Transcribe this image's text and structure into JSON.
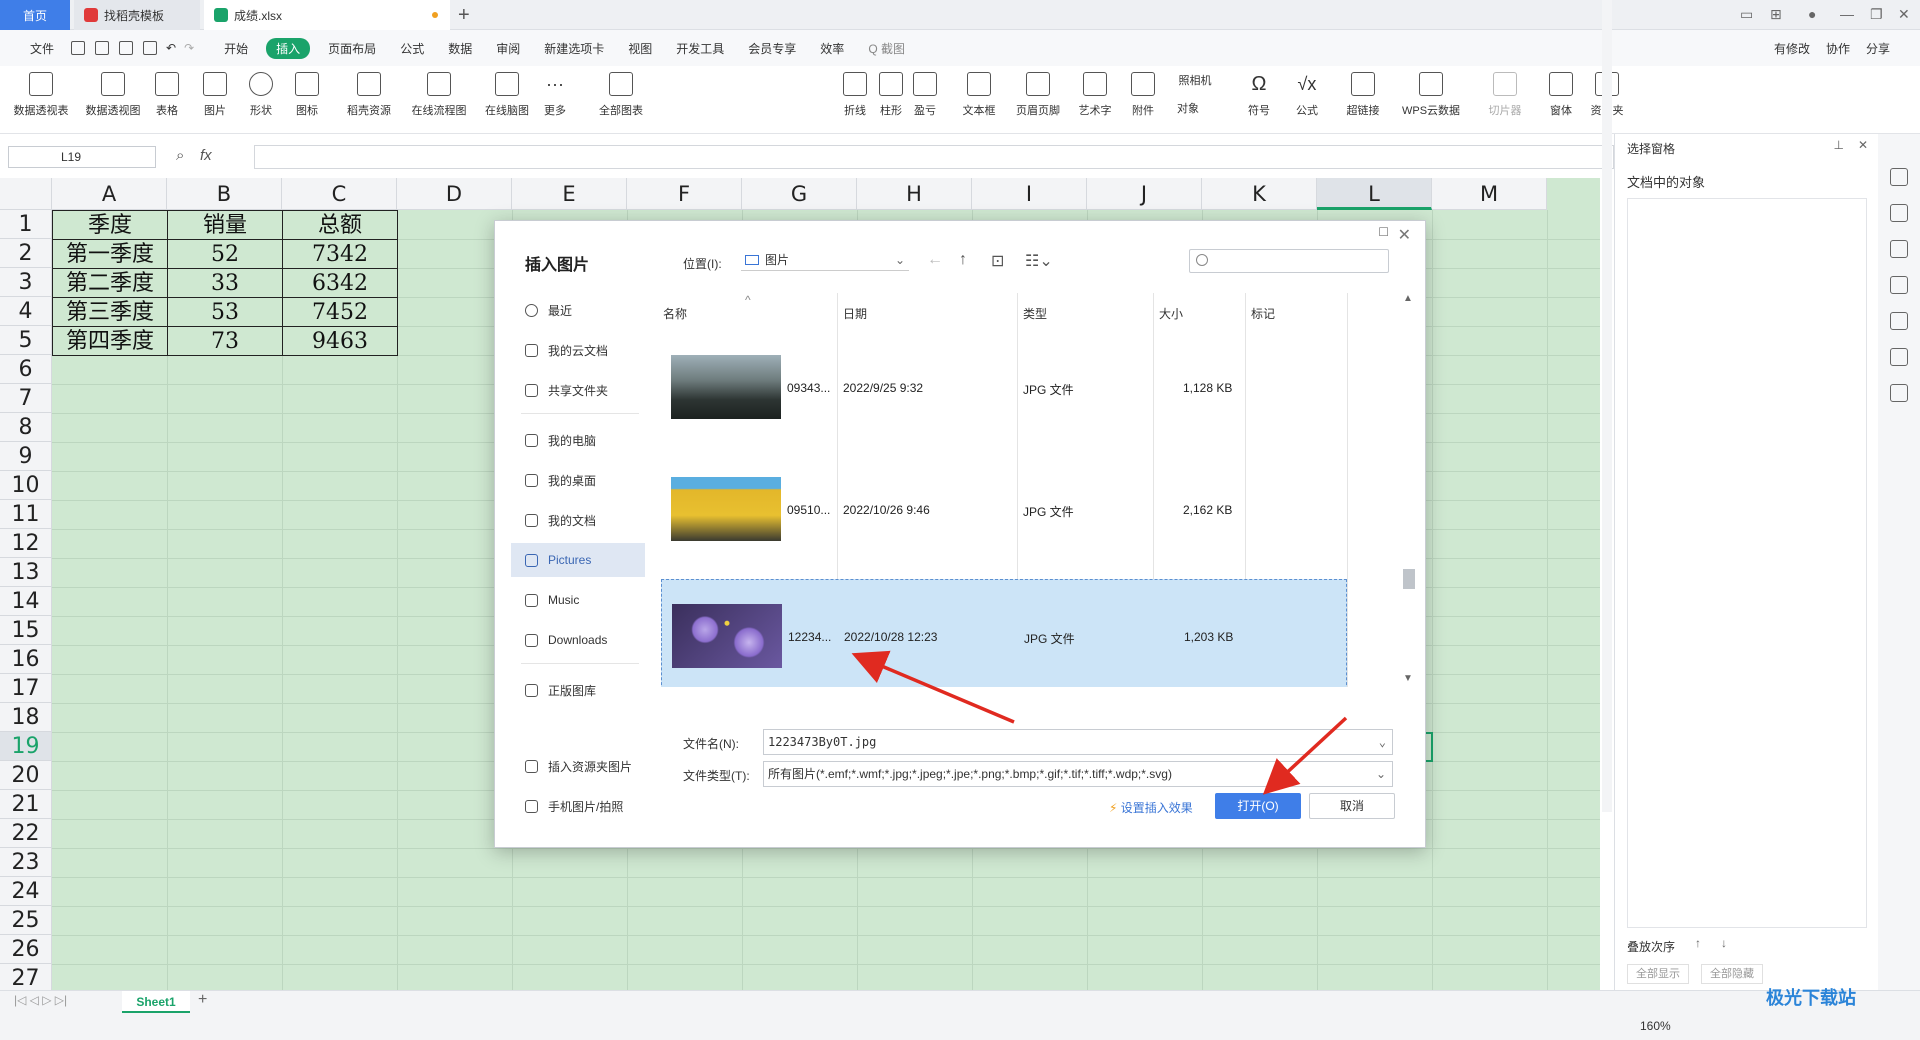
{
  "tabs": {
    "home": "首页",
    "doc1": "找稻壳模板",
    "doc2": "成绩.xlsx",
    "add": "+"
  },
  "menubar": {
    "file": "文件",
    "items": [
      "开始",
      "插入",
      "页面布局",
      "公式",
      "数据",
      "审阅",
      "新建选项卡",
      "视图",
      "开发工具",
      "会员专享",
      "效率"
    ],
    "active": "插入",
    "search": "Q 截图",
    "right": [
      "有修改",
      "协作",
      "分享"
    ]
  },
  "ribbon": [
    "数据透视表",
    "数据透视图",
    "表格",
    "图片",
    "形状",
    "图标",
    "稻壳资源",
    "在线流程图",
    "在线脑图",
    "更多",
    "全部图表",
    "折线",
    "柱形",
    "盈亏",
    "文本框",
    "页眉页脚",
    "艺术字",
    "附件",
    "照相机",
    "对象",
    "符号",
    "公式",
    "超链接",
    "WPS云数据",
    "切片器",
    "窗体",
    "资源夹"
  ],
  "formula_bar": {
    "name_box": "L19",
    "fx": "fx"
  },
  "grid": {
    "columns": [
      "A",
      "B",
      "C",
      "D",
      "E",
      "F",
      "G",
      "H",
      "I",
      "J",
      "K",
      "L",
      "M"
    ],
    "selected_column": "L",
    "rows": [
      "1",
      "2",
      "3",
      "4",
      "5",
      "6",
      "7",
      "8",
      "9",
      "10",
      "11",
      "12",
      "13",
      "14",
      "15",
      "16",
      "17",
      "18",
      "19",
      "20",
      "21",
      "22",
      "23",
      "24",
      "25",
      "26",
      "27"
    ],
    "selected_row": "19",
    "table": [
      [
        "季度",
        "销量",
        "总额"
      ],
      [
        "第一季度",
        "52",
        "7342"
      ],
      [
        "第二季度",
        "33",
        "6342"
      ],
      [
        "第三季度",
        "53",
        "7452"
      ],
      [
        "第四季度",
        "73",
        "9463"
      ]
    ]
  },
  "sheet_tab": "Sheet1",
  "zoom": "160%",
  "right_pane": {
    "title": "选择窗格",
    "subtitle": "文档中的对象",
    "order": "叠放次序",
    "show_all": "全部显示",
    "hide_all": "全部隐藏"
  },
  "dialog": {
    "title": "插入图片",
    "location_label": "位置(I):",
    "location_value": "图片",
    "sidebar": [
      "最近",
      "我的云文档",
      "共享文件夹",
      "我的电脑",
      "我的桌面",
      "我的文档",
      "Pictures",
      "Music",
      "Downloads",
      "正版图库",
      "插入资源夹图片",
      "手机图片/拍照"
    ],
    "active_side": "Pictures",
    "columns": [
      "名称",
      "日期",
      "类型",
      "大小",
      "标记"
    ],
    "files": [
      {
        "name": "09343...",
        "date": "2022/9/25 9:32",
        "type": "JPG 文件",
        "size": "1,128 KB"
      },
      {
        "name": "09510...",
        "date": "2022/10/26 9:46",
        "type": "JPG 文件",
        "size": "2,162 KB"
      },
      {
        "name": "12234...",
        "date": "2022/10/28 12:23",
        "type": "JPG 文件",
        "size": "1,203 KB"
      }
    ],
    "filename_label": "文件名(N):",
    "filename_value": "1223473By0T.jpg",
    "filetype_label": "文件类型(T):",
    "filetype_value": "所有图片(*.emf;*.wmf;*.jpg;*.jpeg;*.jpe;*.png;*.bmp;*.gif;*.tif;*.tiff;*.wdp;*.svg)",
    "set_effect": "设置插入效果",
    "open": "打开(O)",
    "cancel": "取消"
  },
  "watermark": "极光下载站",
  "colors": {
    "accent_green": "#1aa36a",
    "accent_blue": "#3f7ee8",
    "grid_bg": "#cfe8d1",
    "arrow_red": "#e02a20"
  }
}
